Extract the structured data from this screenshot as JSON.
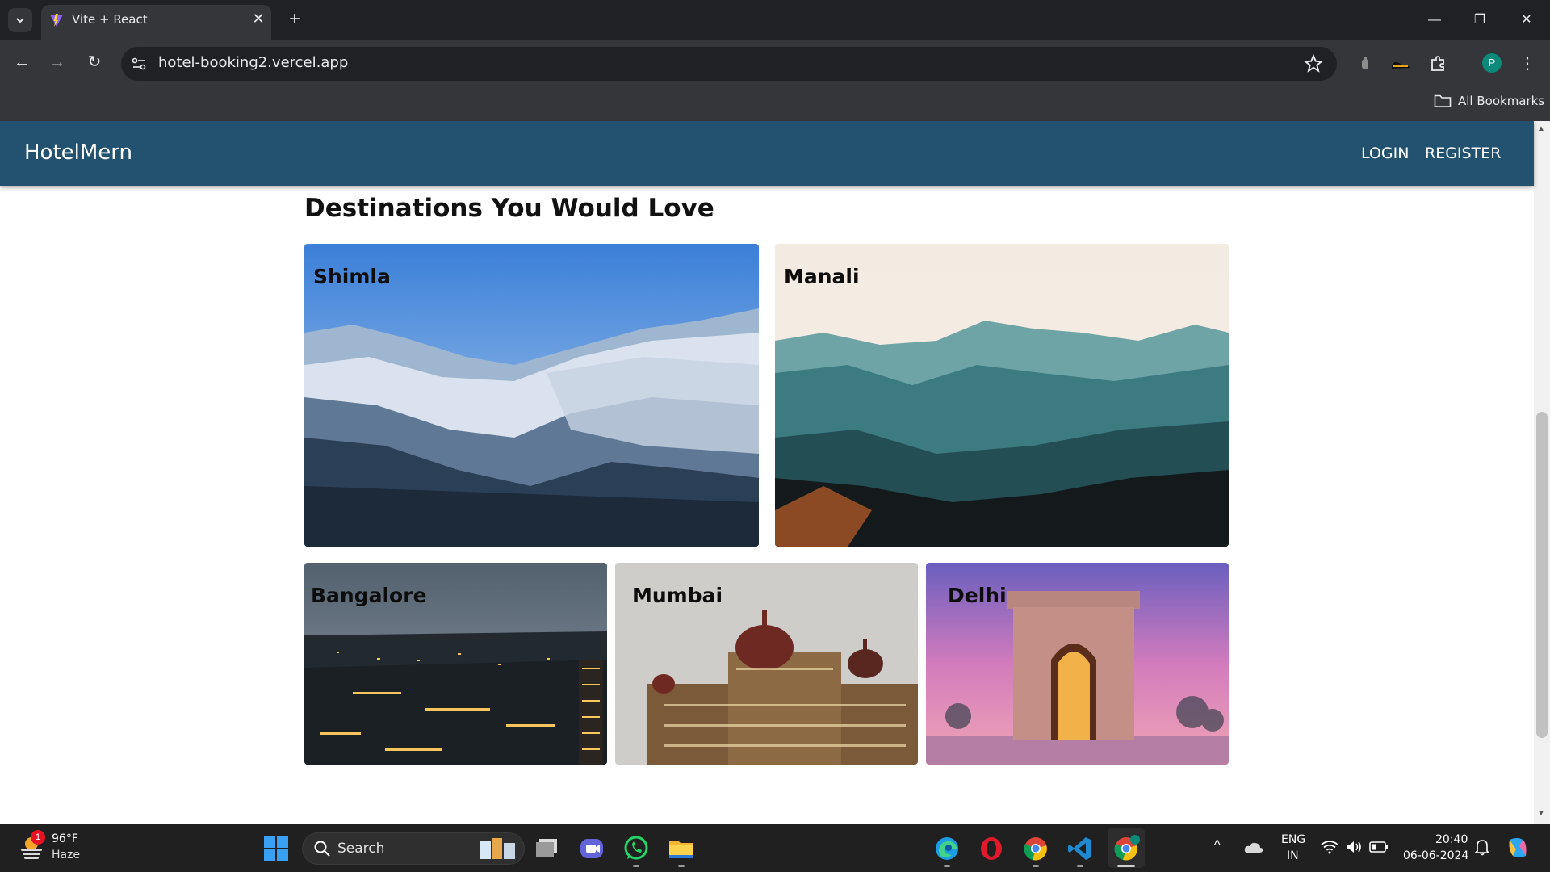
{
  "browser": {
    "tab_title": "Vite + React",
    "url": "hotel-booking2.vercel.app",
    "bookmarks_label": "All Bookmarks",
    "profile_initial": "P"
  },
  "app": {
    "brand": "HotelMern",
    "nav": {
      "login": "LOGIN",
      "register": "REGISTER"
    },
    "header_color": "#22526f"
  },
  "section": {
    "title": "Destinations You Would Love",
    "destinations": [
      {
        "name": "Shimla",
        "image": "snowy-mountain-photo"
      },
      {
        "name": "Manali",
        "image": "teal-mountain-forest-photo"
      },
      {
        "name": "Bangalore",
        "image": "city-night-lights-photo"
      },
      {
        "name": "Mumbai",
        "image": "taj-hotel-photo"
      },
      {
        "name": "Delhi",
        "image": "india-gate-sunset-photo"
      }
    ]
  },
  "taskbar": {
    "weather_temp": "96°F",
    "weather_desc": "Haze",
    "weather_badge": "1",
    "search_label": "Search",
    "lang_line1": "ENG",
    "lang_line2": "IN",
    "time": "20:40",
    "date": "06-06-2024"
  }
}
